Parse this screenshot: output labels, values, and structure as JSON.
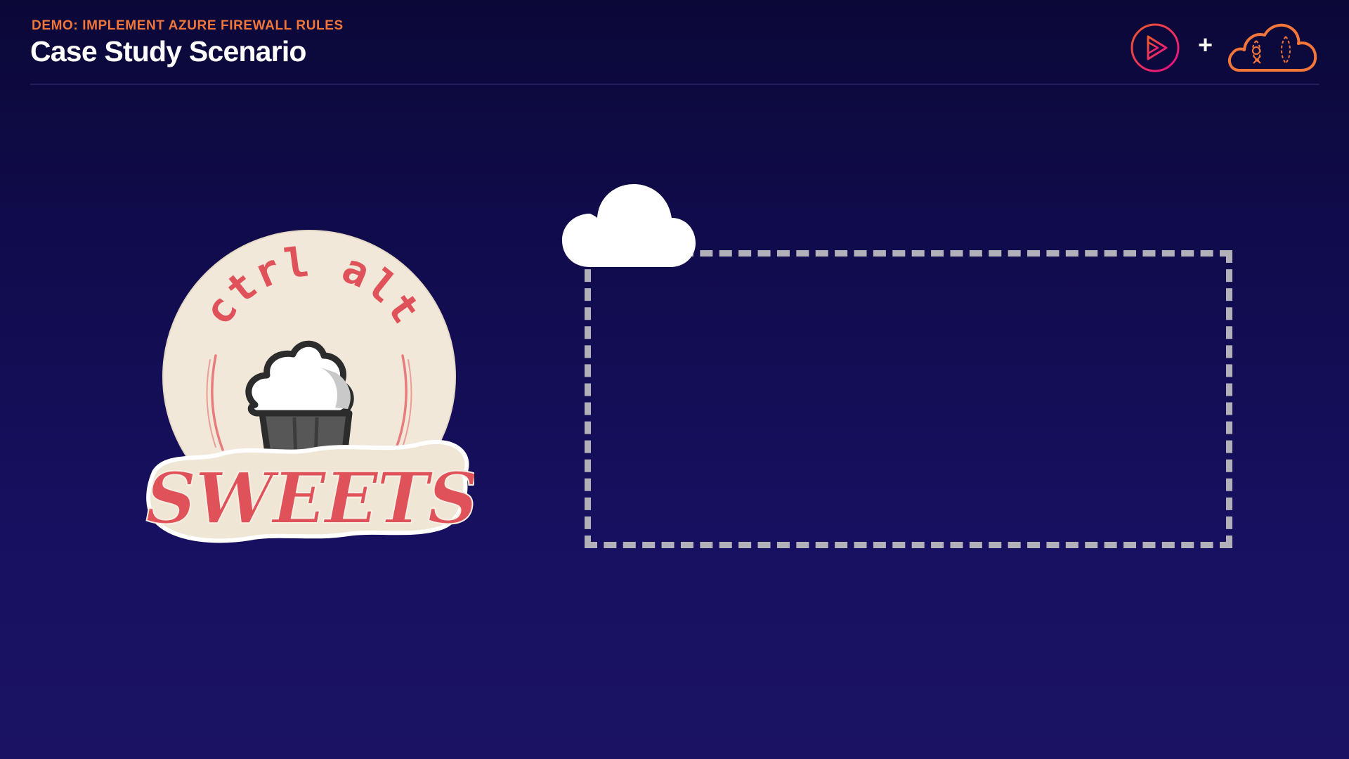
{
  "slide": {
    "eyebrow": "DEMO: IMPLEMENT AZURE FIREWALL RULES",
    "title": "Case Study Scenario"
  },
  "brand": {
    "separator": "+",
    "play_logo_icon": "play-logo-icon",
    "cloud_logo_icon": "acg-cloud-icon"
  },
  "mascot": {
    "top_text": "ctrl alt",
    "bottom_text": "SWEETS",
    "icon": "cupcake-icon"
  },
  "diagram": {
    "cloud_icon": "cloud-icon",
    "boundary": "dashed-network-boundary"
  },
  "colors": {
    "background": "#110c4e",
    "accent_orange": "#f2763a",
    "logo_red": "#e0525a",
    "logo_cream": "#f2e8da",
    "boundary_gray": "#b2b0b9"
  }
}
